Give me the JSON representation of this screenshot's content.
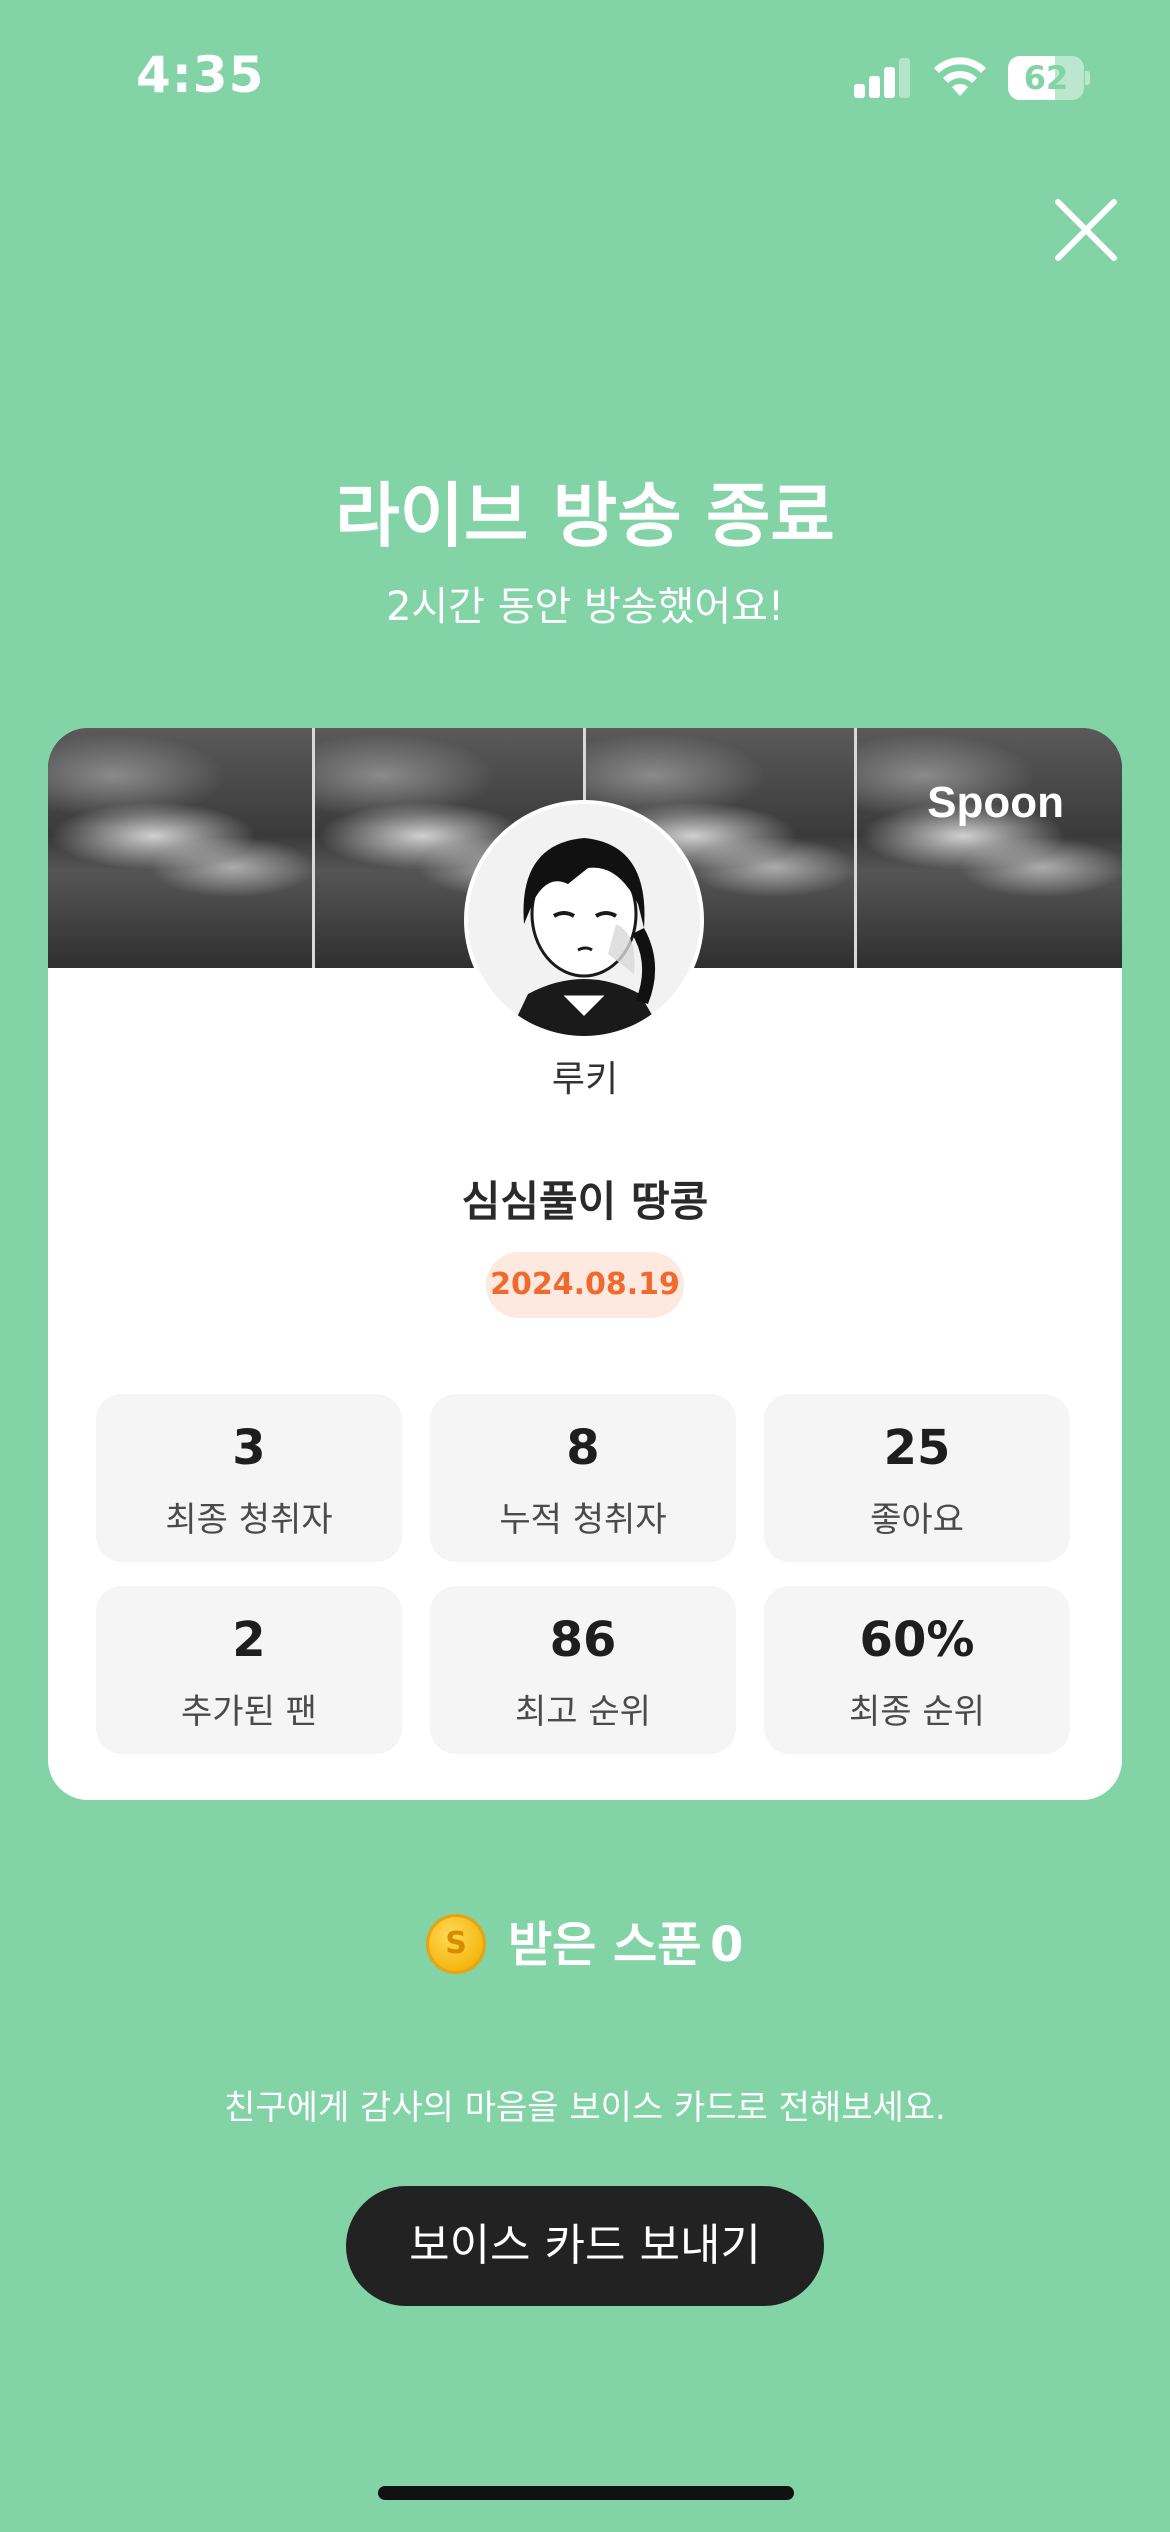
{
  "status_bar": {
    "time": "4:35",
    "battery_percent": "62",
    "battery_level": 0.62,
    "signal_bars": 3,
    "icons": [
      "cellular-signal-icon",
      "wifi-icon",
      "battery-icon"
    ]
  },
  "header": {
    "close_icon": "close-icon",
    "title": "라이브 방송 종료",
    "subtitle": "2시간 동안 방송했어요!"
  },
  "card": {
    "brand": "Spoon",
    "host_name": "루키",
    "broadcast_title": "심심풀이 땅콩",
    "date": "2024.08.19",
    "stats": [
      {
        "value": "3",
        "label": "최종 청취자"
      },
      {
        "value": "8",
        "label": "누적 청취자"
      },
      {
        "value": "25",
        "label": "좋아요"
      },
      {
        "value": "2",
        "label": "추가된 팬"
      },
      {
        "value": "86",
        "label": "최고 순위"
      },
      {
        "value": "60%",
        "label": "최종 순위"
      }
    ]
  },
  "spoons": {
    "icon": "spoon-coin-icon",
    "coin_letter": "S",
    "label": "받은 스푼",
    "count": "0"
  },
  "footer": {
    "message": "친구에게 감사의 마음을 보이스 카드로 전해보세요.",
    "button_label": "보이스 카드 보내기"
  },
  "colors": {
    "background": "#82d4a7",
    "card": "#ffffff",
    "date_badge_bg": "#fde9df",
    "date_badge_text": "#ef6a2c",
    "stat_bg": "#f5f5f5",
    "button_bg": "#222222"
  }
}
